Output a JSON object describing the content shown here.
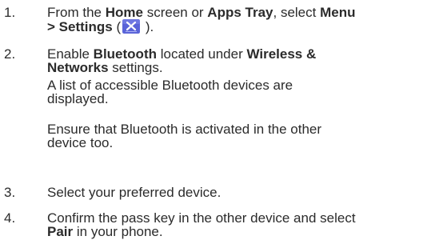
{
  "steps": [
    {
      "number": "1.",
      "line1": {
        "a": "From the ",
        "b1": "Home",
        "c": " screen or ",
        "b2": "Apps Tray",
        "d": ", select ",
        "b3": "Menu"
      },
      "line2": {
        "b": "> Settings",
        "c": " (",
        "d": " )."
      },
      "icon": {
        "name": "settings-icon",
        "bg": "#5a64d8",
        "fg": "#ffffff"
      }
    },
    {
      "number": "2.",
      "line1": {
        "a": "Enable ",
        "b1": "Bluetooth",
        "c": " located under ",
        "b2": "Wireless &"
      },
      "line2": {
        "b": "Networks",
        "c": " settings."
      },
      "para1": {
        "l1": "A list of accessible Bluetooth devices are",
        "l2": "displayed."
      },
      "para2": {
        "l1": "Ensure that Bluetooth is activated in the other",
        "l2": "device too."
      }
    },
    {
      "number": "3.",
      "text": "Select your preferred device."
    },
    {
      "number": "4.",
      "line1": "Confirm the pass key in the other device and select",
      "line2": {
        "b": "Pair",
        "c": " in your phone."
      }
    }
  ]
}
